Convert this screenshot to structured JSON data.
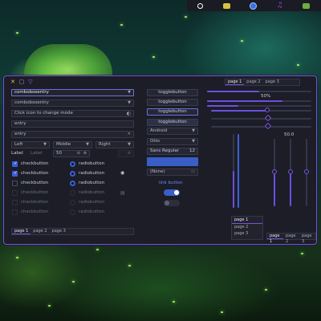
{
  "topbar": {
    "items": [
      {
        "icon": "circle-icon",
        "color": "#ffffff"
      },
      {
        "icon": "folder-icon",
        "color": "#d8c43a"
      },
      {
        "icon": "browser-icon",
        "color": "#3b6ee8"
      },
      {
        "icon": "music-icon",
        "color": "#8a4be0"
      },
      {
        "icon": "edit-icon",
        "color": "#6fae3a"
      }
    ]
  },
  "window": {
    "title_buttons": [
      "✕",
      "▢",
      "▽"
    ],
    "accent": "#7a52d8"
  },
  "left": {
    "combo1": "comboboxentry",
    "combo2": "comboboxentry",
    "icon_entry": "Click icon to change mode",
    "entry1": "entry",
    "entry2": "entry",
    "align": [
      "Left",
      "Middle",
      "Right"
    ],
    "spin": {
      "label1": "Label",
      "label2": "Label",
      "value": "50"
    },
    "checks": [
      {
        "label": "checkbutton",
        "state": "on"
      },
      {
        "label": "checkbutton",
        "state": "on"
      },
      {
        "label": "checkbutton",
        "state": "off"
      },
      {
        "label": "checkbutton",
        "state": "off"
      },
      {
        "label": "checkbutton",
        "state": "off"
      },
      {
        "label": "checkbutton",
        "state": "off"
      }
    ],
    "radios": [
      {
        "label": "radiobutton",
        "state": "on"
      },
      {
        "label": "radiobutton",
        "state": "on"
      },
      {
        "label": "radiobutton",
        "state": "on"
      },
      {
        "label": "radiobutton",
        "state": "off"
      },
      {
        "label": "radiobutton",
        "state": "off"
      },
      {
        "label": "radiobutton",
        "state": "off"
      }
    ],
    "tabs": [
      "page 1",
      "page 2",
      "page 3"
    ]
  },
  "middle": {
    "toggles": [
      "togglebutton",
      "togglebutton",
      "togglebutton",
      "togglebutton"
    ],
    "combo_android": "Android",
    "combo_otto": "Otto",
    "font": "Sans Regular",
    "font_size": "12",
    "none": "(None)",
    "link": "link button",
    "switch1": "on",
    "switch2": "off"
  },
  "right": {
    "tabs_top": [
      "page 1",
      "page 2",
      "page 3"
    ],
    "progress_label": "50%",
    "scale_value": "50.0",
    "tabs_left": [
      "page 1",
      "page 2",
      "page 3"
    ],
    "tabs_bottom": [
      "page 1",
      "page 2",
      "page 3"
    ]
  }
}
